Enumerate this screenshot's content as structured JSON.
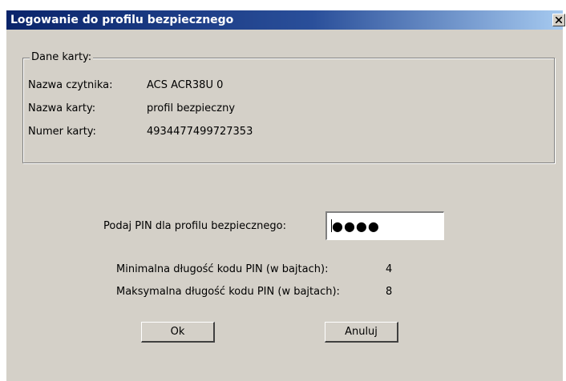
{
  "window": {
    "title": "Logowanie do profilu bezpiecznego"
  },
  "card_group": {
    "legend": "Dane karty:",
    "rows": [
      {
        "label": "Nazwa czytnika:",
        "value": "ACS ACR38U 0"
      },
      {
        "label": "Nazwa karty:",
        "value": "profil bezpieczny"
      },
      {
        "label": "Numer karty:",
        "value": "4934477499727353"
      }
    ]
  },
  "pin": {
    "label": "Podaj PIN dla profilu bezpiecznego:",
    "value": "●●●●"
  },
  "pin_info": {
    "min_label": "Minimalna długość kodu PIN (w bajtach):",
    "min_value": "4",
    "max_label": "Maksymalna długość kodu PIN (w bajtach):",
    "max_value": "8"
  },
  "buttons": {
    "ok": "Ok",
    "cancel": "Anuluj"
  },
  "colors": {
    "titlebar_start": "#0a246a",
    "titlebar_end": "#a6caf0",
    "dialog_face": "#d4d0c8"
  }
}
